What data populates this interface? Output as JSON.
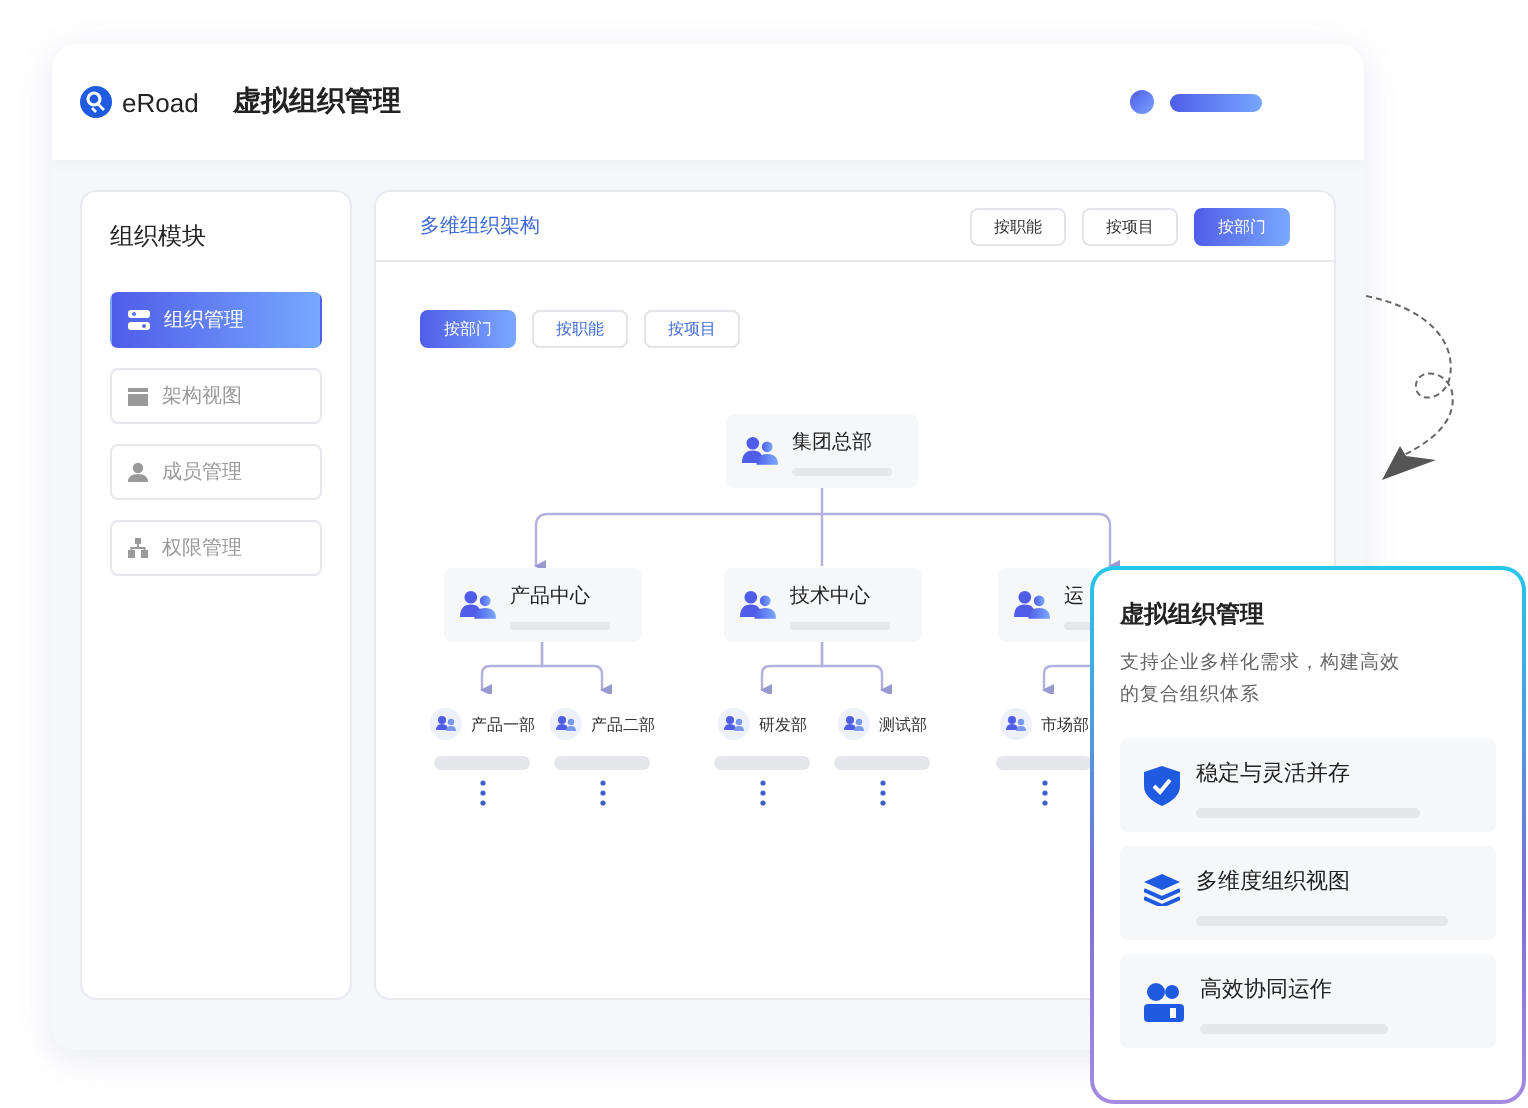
{
  "app": {
    "logo": "eRoad",
    "title": "虚拟组织管理"
  },
  "sidebar": {
    "title": "组织模块",
    "items": [
      {
        "label": "组织管理",
        "kind": "org",
        "selected": true
      },
      {
        "label": "架构视图",
        "kind": "view",
        "selected": false
      },
      {
        "label": "成员管理",
        "kind": "member",
        "selected": false
      },
      {
        "label": "权限管理",
        "kind": "permission",
        "selected": false
      }
    ]
  },
  "panel": {
    "title": "多维组织架构",
    "header_tabs": [
      {
        "label": "按职能",
        "selected": false
      },
      {
        "label": "按项目",
        "selected": false
      },
      {
        "label": "按部门",
        "selected": true
      }
    ],
    "view_tabs": [
      {
        "label": "按部门",
        "selected": true
      },
      {
        "label": "按职能",
        "selected": false
      },
      {
        "label": "按项目",
        "selected": false
      }
    ],
    "org_tree": {
      "label": "集团总部",
      "children": [
        {
          "label": "产品中心",
          "children": [
            {
              "label": "产品一部"
            },
            {
              "label": "产品二部"
            }
          ]
        },
        {
          "label": "技术中心",
          "children": [
            {
              "label": "研发部"
            },
            {
              "label": "测试部"
            }
          ]
        },
        {
          "label": "运",
          "children": [
            {
              "label": "市场部"
            }
          ]
        }
      ]
    }
  },
  "feature_card": {
    "title": "虚拟组织管理",
    "description": "支持企业多样化需求，构建高效的复合组织体系",
    "features": [
      {
        "label": "稳定与灵活并存",
        "kind": "shield"
      },
      {
        "label": "多维度组织视图",
        "kind": "layers"
      },
      {
        "label": "高效协同运作",
        "kind": "team"
      }
    ]
  }
}
